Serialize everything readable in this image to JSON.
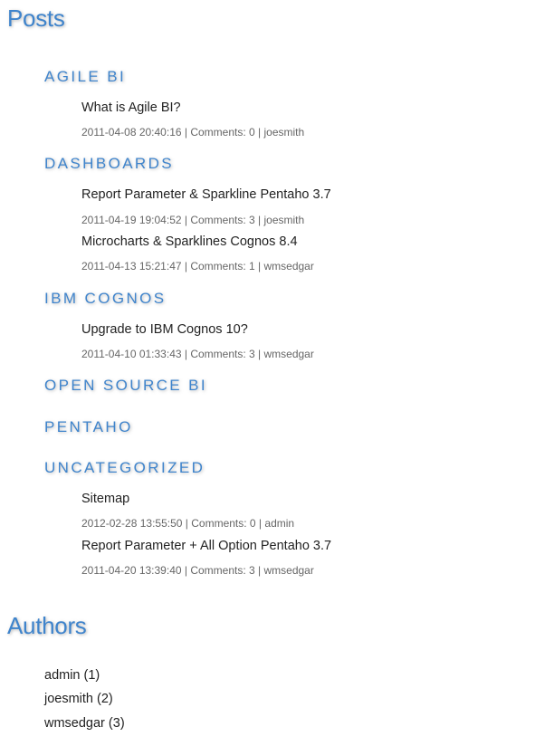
{
  "posts_heading": "Posts",
  "categories": [
    {
      "name": "AGILE BI",
      "posts": [
        {
          "title": "What is Agile BI?",
          "date": "2011-04-08 20:40:16",
          "comments": "Comments: 0",
          "author": "joesmith"
        }
      ]
    },
    {
      "name": "DASHBOARDS",
      "posts": [
        {
          "title": "Report Parameter & Sparkline Pentaho 3.7",
          "date": "2011-04-19 19:04:52",
          "comments": "Comments: 3",
          "author": "joesmith"
        },
        {
          "title": "Microcharts & Sparklines Cognos 8.4",
          "date": "2011-04-13 15:21:47",
          "comments": "Comments: 1",
          "author": "wmsedgar"
        }
      ]
    },
    {
      "name": "IBM COGNOS",
      "posts": [
        {
          "title": "Upgrade to IBM Cognos 10?",
          "date": "2011-04-10 01:33:43",
          "comments": "Comments: 3",
          "author": "wmsedgar"
        }
      ]
    },
    {
      "name": "OPEN SOURCE BI",
      "posts": []
    },
    {
      "name": "PENTAHO",
      "posts": []
    },
    {
      "name": "UNCATEGORIZED",
      "posts": [
        {
          "title": "Sitemap",
          "date": "2012-02-28 13:55:50",
          "comments": "Comments: 0",
          "author": "admin"
        },
        {
          "title": "Report Parameter + All Option Pentaho 3.7",
          "date": "2011-04-20 13:39:40",
          "comments": "Comments: 3",
          "author": "wmsedgar"
        }
      ]
    }
  ],
  "authors_heading": "Authors",
  "authors": [
    {
      "name": "admin",
      "count": "(1)"
    },
    {
      "name": "joesmith",
      "count": "(2)"
    },
    {
      "name": "wmsedgar",
      "count": "(3)"
    }
  ],
  "colors": {
    "heading": "#3f84cc",
    "text": "#222222",
    "meta": "#666666"
  }
}
